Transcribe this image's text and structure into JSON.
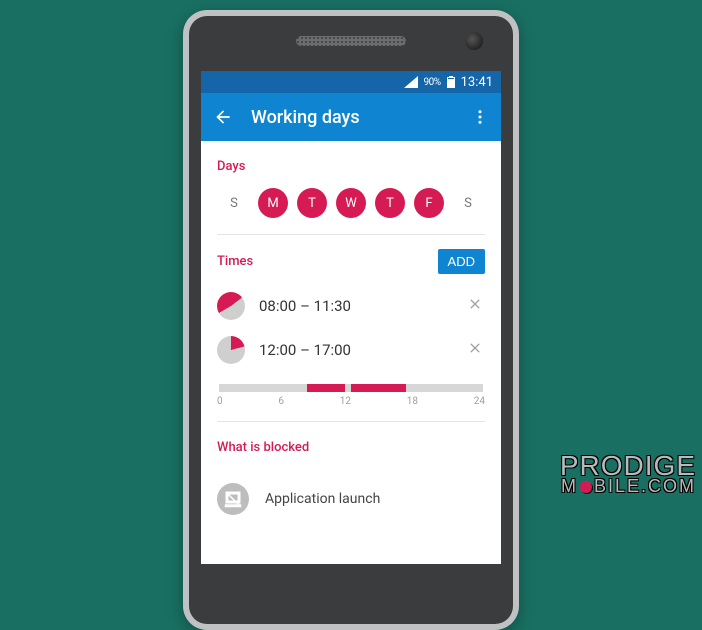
{
  "statusbar": {
    "battery": "90%",
    "time": "13:41"
  },
  "appbar": {
    "title": "Working days"
  },
  "sections": {
    "days_label": "Days",
    "times_label": "Times",
    "blocked_label": "What is blocked"
  },
  "days": [
    {
      "letter": "S",
      "selected": false
    },
    {
      "letter": "M",
      "selected": true
    },
    {
      "letter": "T",
      "selected": true
    },
    {
      "letter": "W",
      "selected": true
    },
    {
      "letter": "T",
      "selected": true
    },
    {
      "letter": "F",
      "selected": true
    },
    {
      "letter": "S",
      "selected": false
    }
  ],
  "add_label": "ADD",
  "times": [
    {
      "label": "08:00 – 11:30",
      "start": 8.0,
      "end": 11.5
    },
    {
      "label": "12:00 – 17:00",
      "start": 12.0,
      "end": 17.0
    }
  ],
  "timeline_ticks": [
    "0",
    "6",
    "12",
    "18",
    "24"
  ],
  "blocked_items": [
    {
      "label": "Application launch",
      "icon": "app-off"
    }
  ],
  "watermark": {
    "line1": "PRODIGE",
    "line2_a": "M",
    "line2_b": "BILE.COM"
  }
}
